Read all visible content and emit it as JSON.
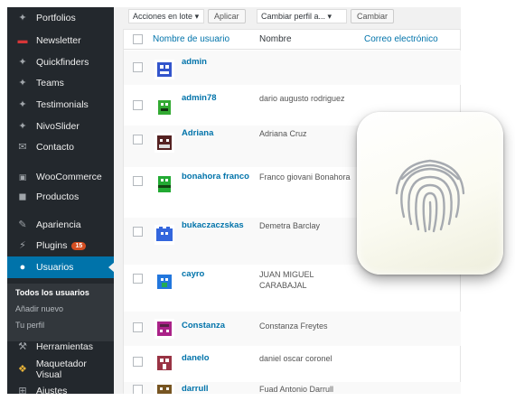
{
  "sidebar": {
    "items": [
      {
        "label": "Portfolios",
        "icon": "pin-icon"
      },
      {
        "label": "Newsletter",
        "icon": "mail-icon"
      },
      {
        "label": "Quickfinders",
        "icon": "pin-icon"
      },
      {
        "label": "Teams",
        "icon": "pin-icon"
      },
      {
        "label": "Testimonials",
        "icon": "pin-icon"
      },
      {
        "label": "NivoSlider",
        "icon": "pin-icon"
      },
      {
        "label": "Contacto",
        "icon": "envelope-icon"
      },
      {
        "label": "WooCommerce",
        "icon": "woo-icon"
      },
      {
        "label": "Productos",
        "icon": "box-icon"
      },
      {
        "label": "Apariencia",
        "icon": "brush-icon"
      },
      {
        "label": "Plugins",
        "icon": "plug-icon",
        "badge": "15"
      },
      {
        "label": "Usuarios",
        "icon": "user-icon",
        "active": true
      },
      {
        "label": "Herramientas",
        "icon": "wrench-icon"
      },
      {
        "label": "Maquetador Visual",
        "icon": "builder-icon"
      },
      {
        "label": "Ajustes",
        "icon": "settings-icon"
      }
    ],
    "submenu": [
      "Todos los usuarios",
      "Añadir nuevo",
      "Tu perfil"
    ],
    "active_color": "#0073aa",
    "badge_color": "#d54e21"
  },
  "toolbar": {
    "bulk_select": "Acciones en lote",
    "apply_label": "Aplicar",
    "role_select": "Cambiar perfil a...",
    "change_label": "Cambiar"
  },
  "table": {
    "headers": [
      "Nombre de usuario",
      "Nombre",
      "Correo electrónico"
    ],
    "rows": [
      {
        "username": "admin",
        "name": "",
        "avatar_color": "#3355cc"
      },
      {
        "username": "admin78",
        "name": "dario augusto rodriguez",
        "avatar_color": "#33aa33"
      },
      {
        "username": "Adriana",
        "name": "Adriana Cruz",
        "avatar_color": "#552222"
      },
      {
        "username": "bonahora franco",
        "name": "Franco giovani Bonahora",
        "avatar_color": "#22aa33"
      },
      {
        "username": "bukaczaczskas",
        "name": "Demetra Barclay",
        "avatar_color": "#3366dd"
      },
      {
        "username": "cayro",
        "name": "JUAN MIGUEL CARABAJAL",
        "avatar_color": "#2277dd"
      },
      {
        "username": "Constanza",
        "name": "Constanza Freytes",
        "avatar_color": "#aa2288"
      },
      {
        "username": "danelo",
        "name": "daniel oscar coronel",
        "avatar_color": "#993344"
      },
      {
        "username": "darrull",
        "name": "Fuad Antonio Darrull",
        "avatar_color": "#775522"
      }
    ]
  },
  "overlay": {
    "icon": "fingerprint-icon"
  }
}
